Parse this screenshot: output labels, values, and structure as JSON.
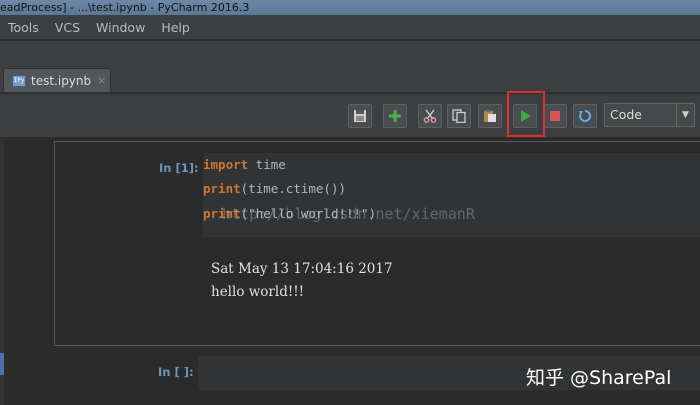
{
  "window": {
    "title": "eadProcess] - ...\\test.ipynb - PyCharm 2016.3"
  },
  "menu": {
    "items": [
      "Tools",
      "VCS",
      "Window",
      "Help"
    ]
  },
  "tabs": [
    {
      "label": "test.ipynb",
      "icon": "notebook-file-icon",
      "icon_text": "IPy",
      "close": "×"
    }
  ],
  "toolbar": {
    "buttons": [
      "save-icon",
      "add-cell-icon",
      "cut-icon",
      "copy-icon",
      "paste-icon",
      "run-icon",
      "stop-icon",
      "restart-icon"
    ],
    "cell_type_value": "Code",
    "dropdown_arrow": "▼"
  },
  "cells": [
    {
      "prompt": "In [1]:",
      "code": [
        {
          "keyword": "import",
          "rest": " time"
        },
        {
          "keyword": "print",
          "rest": "(time.ctime())"
        },
        {
          "keyword": "print",
          "rest": "(\"hello world!!!\")"
        }
      ],
      "output": [
        "Sat May 13 17:04:16 2017",
        "hello world!!!"
      ]
    },
    {
      "prompt": "In [ ]:"
    }
  ],
  "overlays": {
    "watermark_url": "http://blog.csdn.net/xiemanR",
    "zhihu_text": "知乎 @SharePal"
  },
  "colors": {
    "background": "#2b2b2b",
    "panel": "#3c3f41",
    "keyword": "#cc7832",
    "prompt": "#6897bb",
    "run_green": "#3cad3c",
    "stop_red": "#d9534f",
    "highlight_red": "#d9312b"
  }
}
